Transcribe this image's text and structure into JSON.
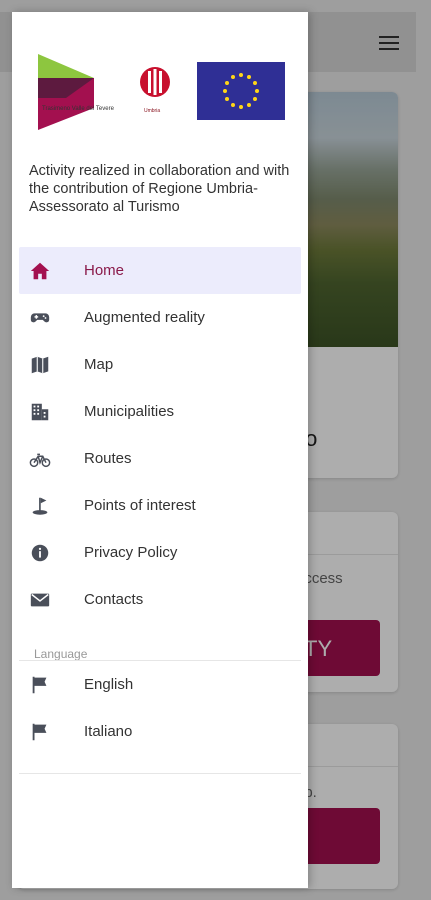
{
  "background": {
    "card_title_partial": "ino",
    "card2_text_partial": "access",
    "card2_button_partial": "TY",
    "card3_text_partial": "ap."
  },
  "drawer": {
    "logos": {
      "tc_text": "Trasimeno Valle del Tevere",
      "umbria_text": "Umbria"
    },
    "intro": "Activity realized in collaboration and with the contribution of Regione Umbria-Assessorato al Turismo",
    "nav_items": [
      {
        "label": "Home",
        "icon": "home-icon",
        "active": true
      },
      {
        "label": "Augmented reality",
        "icon": "gamepad-icon",
        "active": false
      },
      {
        "label": "Map",
        "icon": "map-icon",
        "active": false
      },
      {
        "label": "Municipalities",
        "icon": "building-icon",
        "active": false
      },
      {
        "label": "Routes",
        "icon": "bicycle-icon",
        "active": false
      },
      {
        "label": "Points of interest",
        "icon": "golf-flag-icon",
        "active": false
      },
      {
        "label": "Privacy Policy",
        "icon": "info-icon",
        "active": false
      },
      {
        "label": "Contacts",
        "icon": "mail-icon",
        "active": false
      }
    ],
    "language_section_label": "Language",
    "languages": [
      {
        "label": "English",
        "icon": "flag-icon"
      },
      {
        "label": "Italiano",
        "icon": "flag-icon"
      }
    ]
  },
  "colors": {
    "accent": "#a3104f",
    "active_bg": "#ececfc",
    "active_text": "#8a1a4a",
    "icon": "#4a4f5a"
  }
}
